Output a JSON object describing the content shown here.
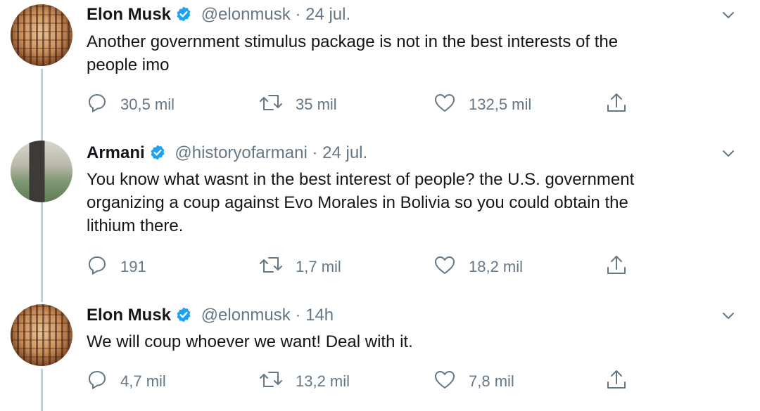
{
  "tweets": [
    {
      "name": "Elon Musk",
      "handle": "@elonmusk",
      "separator": "·",
      "time": "24 jul.",
      "text": "Another government stimulus package is not in the best interests of the\npeople imo",
      "replies": "30,5 mil",
      "retweets": "35 mil",
      "likes": "132,5 mil"
    },
    {
      "name": "Armani",
      "handle": "@historyofarmani",
      "separator": "·",
      "time": "24 jul.",
      "text": "You know what wasnt in the best interest of people? the U.S. government\norganizing a coup against Evo Morales in Bolivia so you could obtain the\nlithium there.",
      "replies": "191",
      "retweets": "1,7 mil",
      "likes": "18,2 mil"
    },
    {
      "name": "Elon Musk",
      "handle": "@elonmusk",
      "separator": "·",
      "time": "14h",
      "text": "We will coup whoever we want! Deal with it.",
      "replies": "4,7 mil",
      "retweets": "13,2 mil",
      "likes": "7,8 mil"
    }
  ],
  "colors": {
    "verified": "#1da1f2",
    "secondary_text": "#657786",
    "thread_line": "#c4cfd6"
  },
  "icons": [
    "reply-icon",
    "retweet-icon",
    "like-icon",
    "share-icon",
    "chevron-down-icon",
    "verified-badge-icon"
  ]
}
